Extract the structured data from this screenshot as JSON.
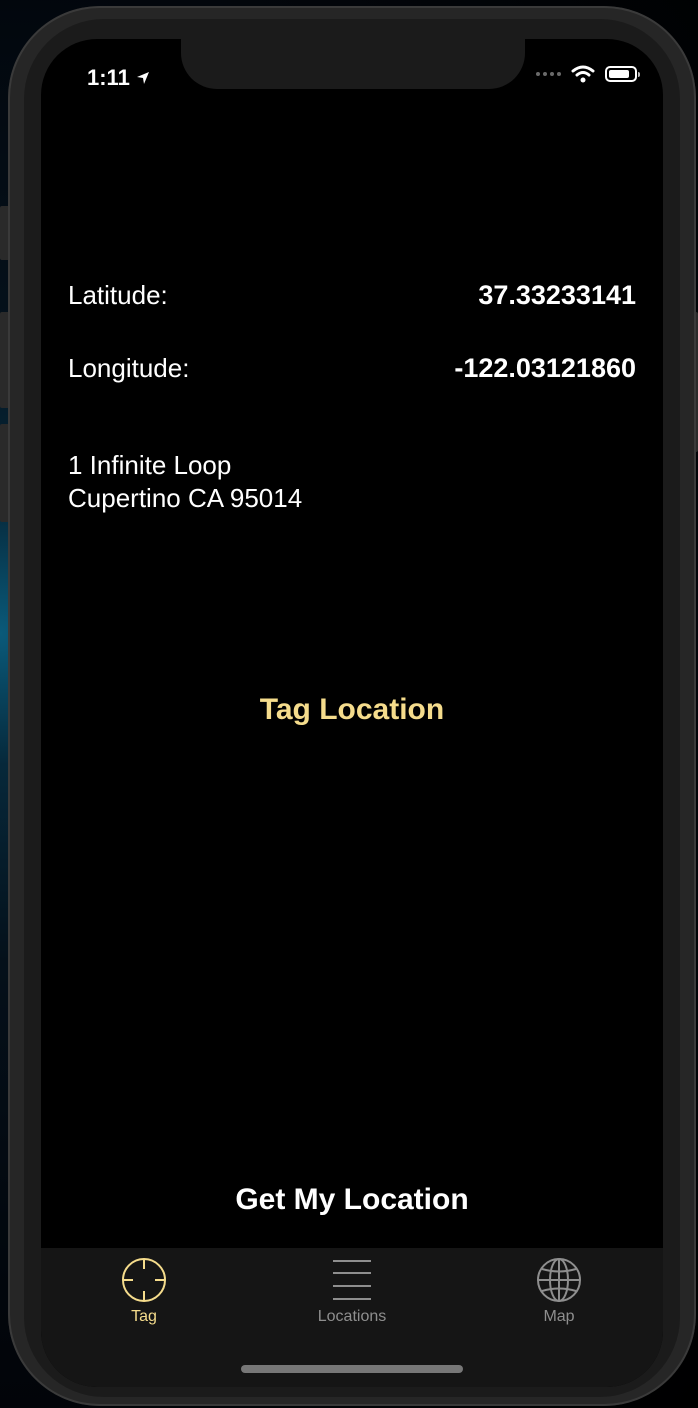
{
  "status_bar": {
    "time": "1:11",
    "location_icon": "location-arrow-icon",
    "signal_icon": "signal-dots-icon",
    "wifi_icon": "wifi-icon",
    "battery_icon": "battery-icon"
  },
  "coordinates": {
    "latitude_label": "Latitude:",
    "latitude_value": "37.33233141",
    "longitude_label": "Longitude:",
    "longitude_value": "-122.03121860"
  },
  "address": {
    "line1": "1 Infinite Loop",
    "line2": "Cupertino CA 95014"
  },
  "actions": {
    "tag_location_label": "Tag Location",
    "get_my_location_label": "Get My Location"
  },
  "tab_bar": {
    "tabs": [
      {
        "label": "Tag",
        "icon": "crosshair-icon",
        "selected": true
      },
      {
        "label": "Locations",
        "icon": "list-lines-icon",
        "selected": false
      },
      {
        "label": "Map",
        "icon": "globe-icon",
        "selected": false
      }
    ]
  },
  "colors": {
    "accent": "#F5DC8C",
    "background": "#000000",
    "tab_inactive": "#8E8E8E",
    "tab_bar_bg": "#151515"
  }
}
